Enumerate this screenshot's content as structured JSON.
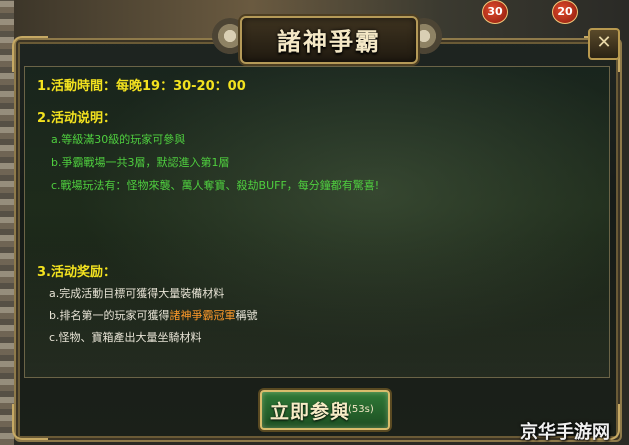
{
  "title": "諸神爭霸",
  "hud": {
    "badge_1": "30",
    "badge_2": "20"
  },
  "section1": {
    "label": "1.活動時間：",
    "value": "每晚19：30-20：00"
  },
  "section2": {
    "heading": "2.活动说明：",
    "items": [
      "a.等級滿30級的玩家可參與",
      "b.爭霸戰場一共3層，默認進入第1層",
      "c.戰場玩法有：怪物來襲、萬人奪寶、殺劫BUFF，每分鐘都有驚喜!"
    ]
  },
  "section3": {
    "heading": "3.活动奖励：",
    "item_a": "a.完成活動目標可獲得大量裝備材料",
    "item_b_prefix": "b.排名第一的玩家可獲得",
    "item_b_highlight": "諸神爭霸冠軍",
    "item_b_suffix": "稱號",
    "item_c": "c.怪物、寶箱產出大量坐騎材料"
  },
  "join_button": {
    "label": "立即参與",
    "countdown": "(53s)"
  },
  "watermark": "京华手游网",
  "colors": {
    "heading": "#f3e21f",
    "green_text": "#4fcf3f",
    "highlight": "#ff9a2a",
    "button": "#2f7a37"
  }
}
